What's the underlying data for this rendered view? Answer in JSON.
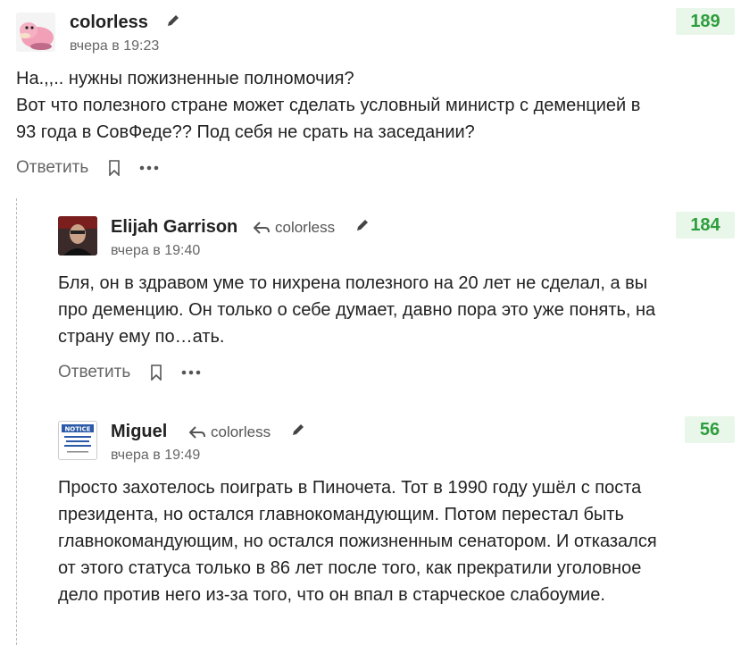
{
  "comments": [
    {
      "author": "colorless",
      "time": "вчера в 19:23",
      "score": "189",
      "text": "На.,,.. нужны пожизненные полномочия?\nВот что полезного стране может сделать условный министр с деменцией в 93 года в СовФеде?? Под себя не срать на заседании?",
      "reply_label": "Ответить"
    },
    {
      "author": "Elijah Garrison",
      "reply_to": "colorless",
      "time": "вчера в 19:40",
      "score": "184",
      "text": "Бля, он в здравом уме то нихрена полезного на 20 лет не сделал, а вы про деменцию. Он только о себе думает, давно пора это уже понять, на страну ему по…ать.",
      "reply_label": "Ответить"
    },
    {
      "author": "Miguel",
      "reply_to": "colorless",
      "time": "вчера в 19:49",
      "score": "56",
      "text": "Просто захотелось поиграть в Пиночета. Тот в 1990 году ушёл с поста президента, но остался главнокомандующим. Потом перестал быть главнокомандующим, но остался пожизненным сенатором. И отказался от этого статуса только в 86 лет после того, как прекратили уголовное дело против него из-за того, что он впал в старческое слабоумие."
    }
  ],
  "avatars": {
    "miguel_sign": [
      "NOTICE",
      "THANK YOU",
      "FOR NOTICING THIS",
      "NEW NOTICE"
    ]
  },
  "colors": {
    "score_bg": "#e9f6ea",
    "score_text": "#2e9e3d"
  }
}
